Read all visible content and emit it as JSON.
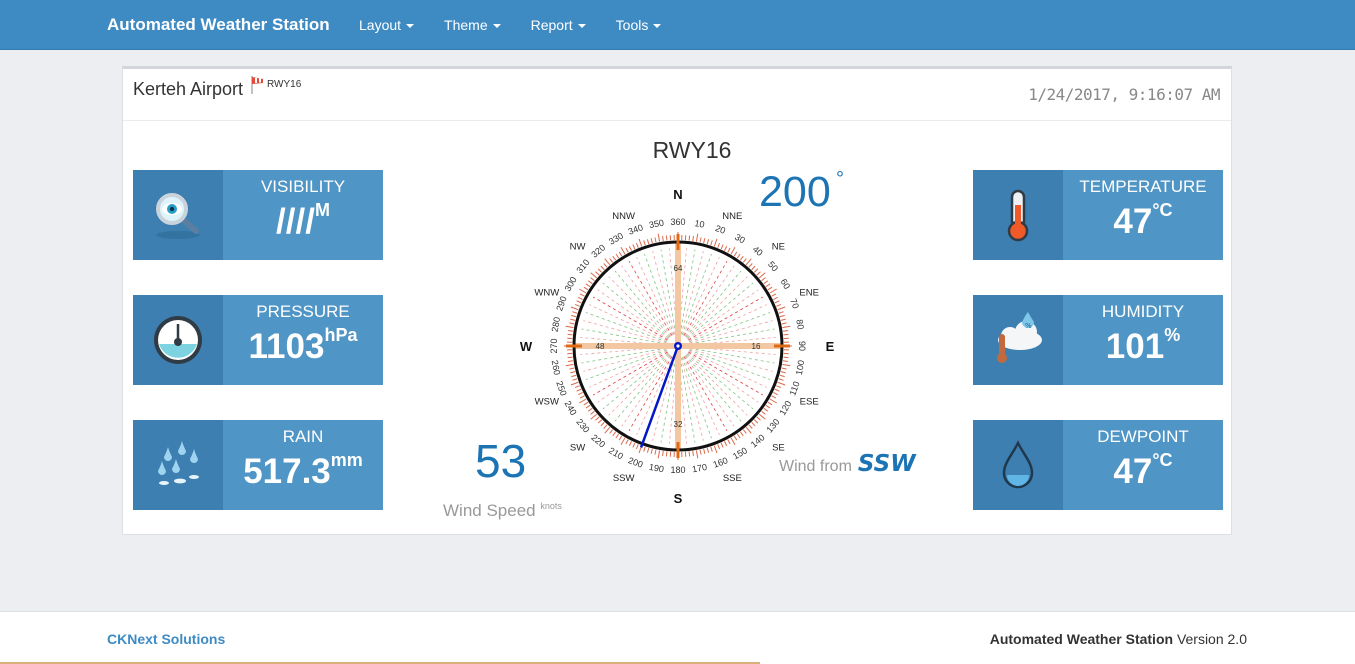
{
  "app": {
    "title": "Automated Weather Station"
  },
  "nav": [
    {
      "label": "Layout"
    },
    {
      "label": "Theme"
    },
    {
      "label": "Report"
    },
    {
      "label": "Tools"
    }
  ],
  "panel": {
    "station": "Kerteh Airport",
    "runway_tag": "RWY16",
    "datetime": "1/24/2017, 9:16:07 AM"
  },
  "tiles": {
    "visibility": {
      "label": "VISIBILITY",
      "value": "////",
      "unit": "M",
      "icon": "magnifier-eye-icon"
    },
    "pressure": {
      "label": "PRESSURE",
      "value": "1103",
      "unit": "hPa",
      "icon": "barometer-gauge-icon"
    },
    "rain": {
      "label": "RAIN",
      "value": "517.3",
      "unit": "mm",
      "icon": "raindrops-icon"
    },
    "temperature": {
      "label": "TEMPERATURE",
      "value": "47",
      "unit": "°C",
      "icon": "thermometer-icon"
    },
    "humidity": {
      "label": "HUMIDITY",
      "value": "101",
      "unit": "%",
      "icon": "humidity-cloud-icon"
    },
    "dewpoint": {
      "label": "DEWPOINT",
      "value": "47",
      "unit": "°C",
      "icon": "water-drop-icon"
    }
  },
  "wind": {
    "runway": "RWY16",
    "direction_value": "200",
    "degree_symbol": "°",
    "direction_deg": 200,
    "speed": "53",
    "speed_label": "Wind Speed",
    "speed_unit": "knots",
    "from_label": "Wind from",
    "from_value": "SSW",
    "cardinals": [
      "N",
      "E",
      "S",
      "W"
    ],
    "intercardinals": [
      "NNE",
      "NE",
      "ENE",
      "ESE",
      "SE",
      "SSE",
      "SSW",
      "SW",
      "WSW",
      "WNW",
      "NW",
      "NNW"
    ],
    "degree_ticks": [
      "10",
      "20",
      "30",
      "40",
      "50",
      "60",
      "70",
      "80",
      "90",
      "100",
      "110",
      "120",
      "130",
      "140",
      "150",
      "160",
      "170",
      "180",
      "190",
      "200",
      "210",
      "220",
      "230",
      "240",
      "250",
      "260",
      "270",
      "280",
      "290",
      "300",
      "310",
      "320",
      "330",
      "340",
      "350",
      "360"
    ],
    "inner_labels": [
      "64",
      "16",
      "32",
      "48"
    ]
  },
  "footer": {
    "company": "CKNext Solutions",
    "app_name": "Automated Weather Station",
    "version": "Version 2.0"
  },
  "colors": {
    "navbar": "#3e8bc4",
    "tile": "#4f95c5",
    "tile_icon_bg": "#3d7fb1",
    "accent": "#1c74b4",
    "needle": "#0018c8"
  }
}
